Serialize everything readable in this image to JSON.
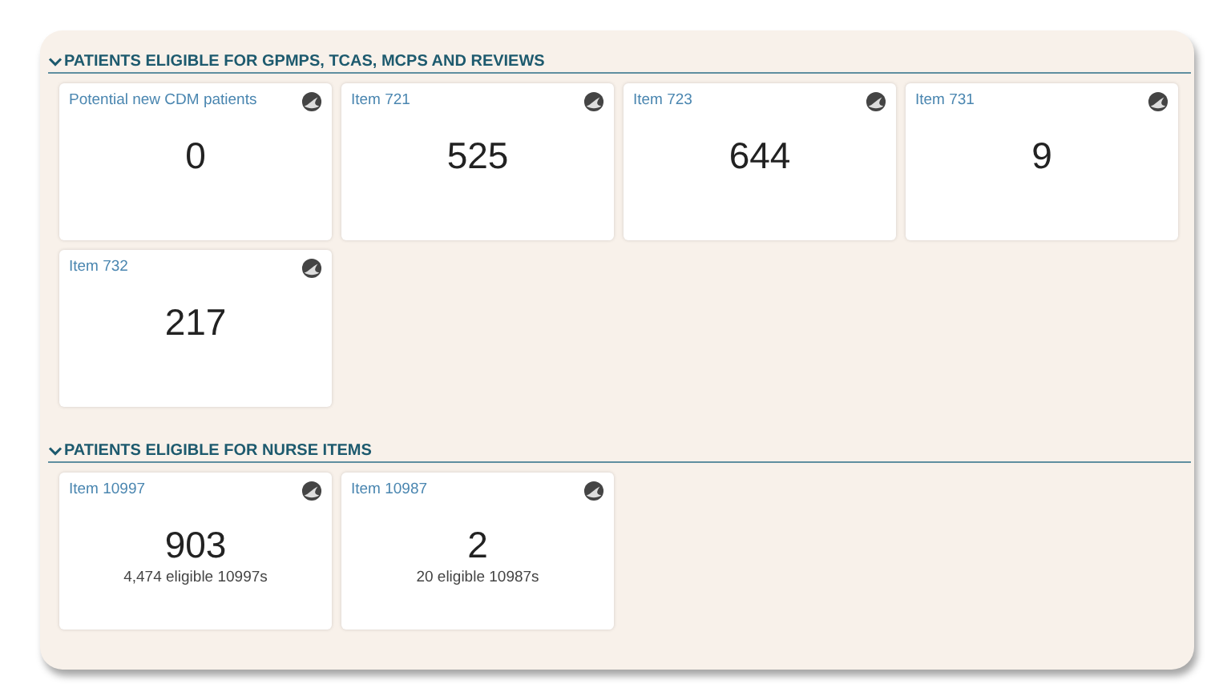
{
  "sections": [
    {
      "title": "PATIENTS ELIGIBLE FOR GPMPS, TCAS, MCPS AND REVIEWS",
      "expanded": true,
      "cards": [
        {
          "label": "Potential new CDM patients",
          "value": "0"
        },
        {
          "label": "Item 721",
          "value": "525"
        },
        {
          "label": "Item 723",
          "value": "644"
        },
        {
          "label": "Item 731",
          "value": "9"
        },
        {
          "label": "Item 732",
          "value": "217"
        }
      ]
    },
    {
      "title": "PATIENTS ELIGIBLE FOR NURSE ITEMS",
      "expanded": true,
      "cards": [
        {
          "label": "Item 10997",
          "value": "903",
          "sub": "4,474 eligible 10997s"
        },
        {
          "label": "Item 10987",
          "value": "2",
          "sub": "20 eligible 10987s"
        }
      ]
    }
  ]
}
